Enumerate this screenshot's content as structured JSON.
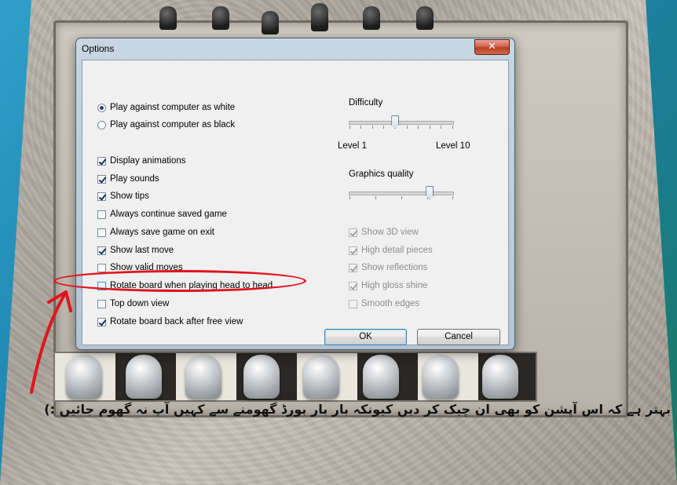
{
  "dialog": {
    "title": "Options",
    "close_glyph": "✕"
  },
  "play_mode": [
    {
      "label": "Play against computer as white",
      "selected": true
    },
    {
      "label": "Play against computer as black",
      "selected": false
    }
  ],
  "options": [
    {
      "label": "Display animations",
      "checked": true
    },
    {
      "label": "Play sounds",
      "checked": true
    },
    {
      "label": "Show tips",
      "checked": true
    },
    {
      "label": "Always continue saved game",
      "checked": false
    },
    {
      "label": "Always save game on exit",
      "checked": false
    },
    {
      "label": "Show last move",
      "checked": true
    },
    {
      "label": "Show valid moves",
      "checked": false
    },
    {
      "label": "Rotate board when playing head to head",
      "checked": false
    },
    {
      "label": "Top down view",
      "checked": false
    },
    {
      "label": "Rotate board back after free view",
      "checked": true
    }
  ],
  "difficulty": {
    "label": "Difficulty",
    "min_label": "Level 1",
    "max_label": "Level 10",
    "value": 5,
    "min": 1,
    "max": 10
  },
  "graphics": {
    "label": "Graphics quality",
    "level_fraction": 0.78,
    "options": [
      {
        "label": "Show 3D view",
        "checked": true
      },
      {
        "label": "High detail pieces",
        "checked": true
      },
      {
        "label": "Show reflections",
        "checked": true
      },
      {
        "label": "High gloss shine",
        "checked": true
      },
      {
        "label": "Smooth edges",
        "checked": false
      }
    ]
  },
  "buttons": {
    "ok": "OK",
    "cancel": "Cancel"
  },
  "annotation": {
    "note": "بہتر ہے کہ اس آپشن کو بھی ان چیک کر دیں کیونکہ بار بار بورڈ گھومنے سے کہیں آپ نہ گھوم جائیں :)",
    "color": "#e0141c"
  }
}
